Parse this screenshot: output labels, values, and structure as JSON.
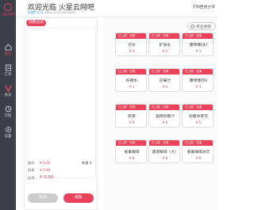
{
  "brand": {
    "name": "火星云网吧"
  },
  "nav": [
    {
      "label": "前台",
      "icon": "home-icon"
    },
    {
      "label": "订单",
      "icon": "order-icon"
    },
    {
      "label": "会员",
      "icon": "member-icon"
    },
    {
      "label": "交班",
      "icon": "shift-icon"
    },
    {
      "label": "设置",
      "icon": "settings-icon"
    }
  ],
  "header": {
    "welcome": "欢迎光临 火星云网吧",
    "status_label": "收银员(123)",
    "timestamp": "2020-12-22 00:00:00",
    "right": "夕阳西进分享"
  },
  "order": {
    "tag": "消费会员",
    "total_label": "原价",
    "total_value": "¥ 0.00",
    "discount_label": "折扣",
    "discount_value": "¥ 0.00",
    "count_label": "数量",
    "count_value": "0",
    "payable_label": "应付",
    "payable_value": "¥ 0.00",
    "cancel_label": "取消",
    "checkout_label": "结账"
  },
  "search": {
    "placeholder": "商品搜索"
  },
  "products": [
    {
      "badge": "已上架 · 无库",
      "name": "可乐",
      "price": "¥ 3"
    },
    {
      "badge": "已上架 · 无库",
      "name": "矿泉水",
      "price": "¥ 2"
    },
    {
      "badge": "已上架 · 无库",
      "name": "康师傅(冰)",
      "price": "¥ 3"
    },
    {
      "badge": "已上架 · 无库",
      "name": "柠檬水",
      "price": "¥ 3"
    },
    {
      "badge": "已上架 · 无库",
      "name": "芒果汁",
      "price": "¥ 5"
    },
    {
      "badge": "已上架 · 无库",
      "name": "康师傅(热)",
      "price": "¥ 3"
    },
    {
      "badge": "已上架 · 无库",
      "name": "奶茶",
      "price": "¥ 6"
    },
    {
      "badge": "已上架 · 无库",
      "name": "金桔柠檬汁",
      "price": "¥ 6"
    },
    {
      "badge": "已上架 · 无库",
      "name": "柠檬冰茶饮",
      "price": "¥ 5"
    },
    {
      "badge": "已上架 · 无库",
      "name": "雀巢咖啡",
      "price": "¥ 8"
    },
    {
      "badge": "已上架 · 无库",
      "name": "速溶咖啡（大）",
      "price": "¥ 8"
    },
    {
      "badge": "已上架 · 无库",
      "name": "雀巢咖啡冰饮",
      "price": "¥ 9"
    }
  ],
  "colors": {
    "accent": "#e8435a",
    "sidebar": "#3b3f4a",
    "link": "#2aa0d8"
  }
}
